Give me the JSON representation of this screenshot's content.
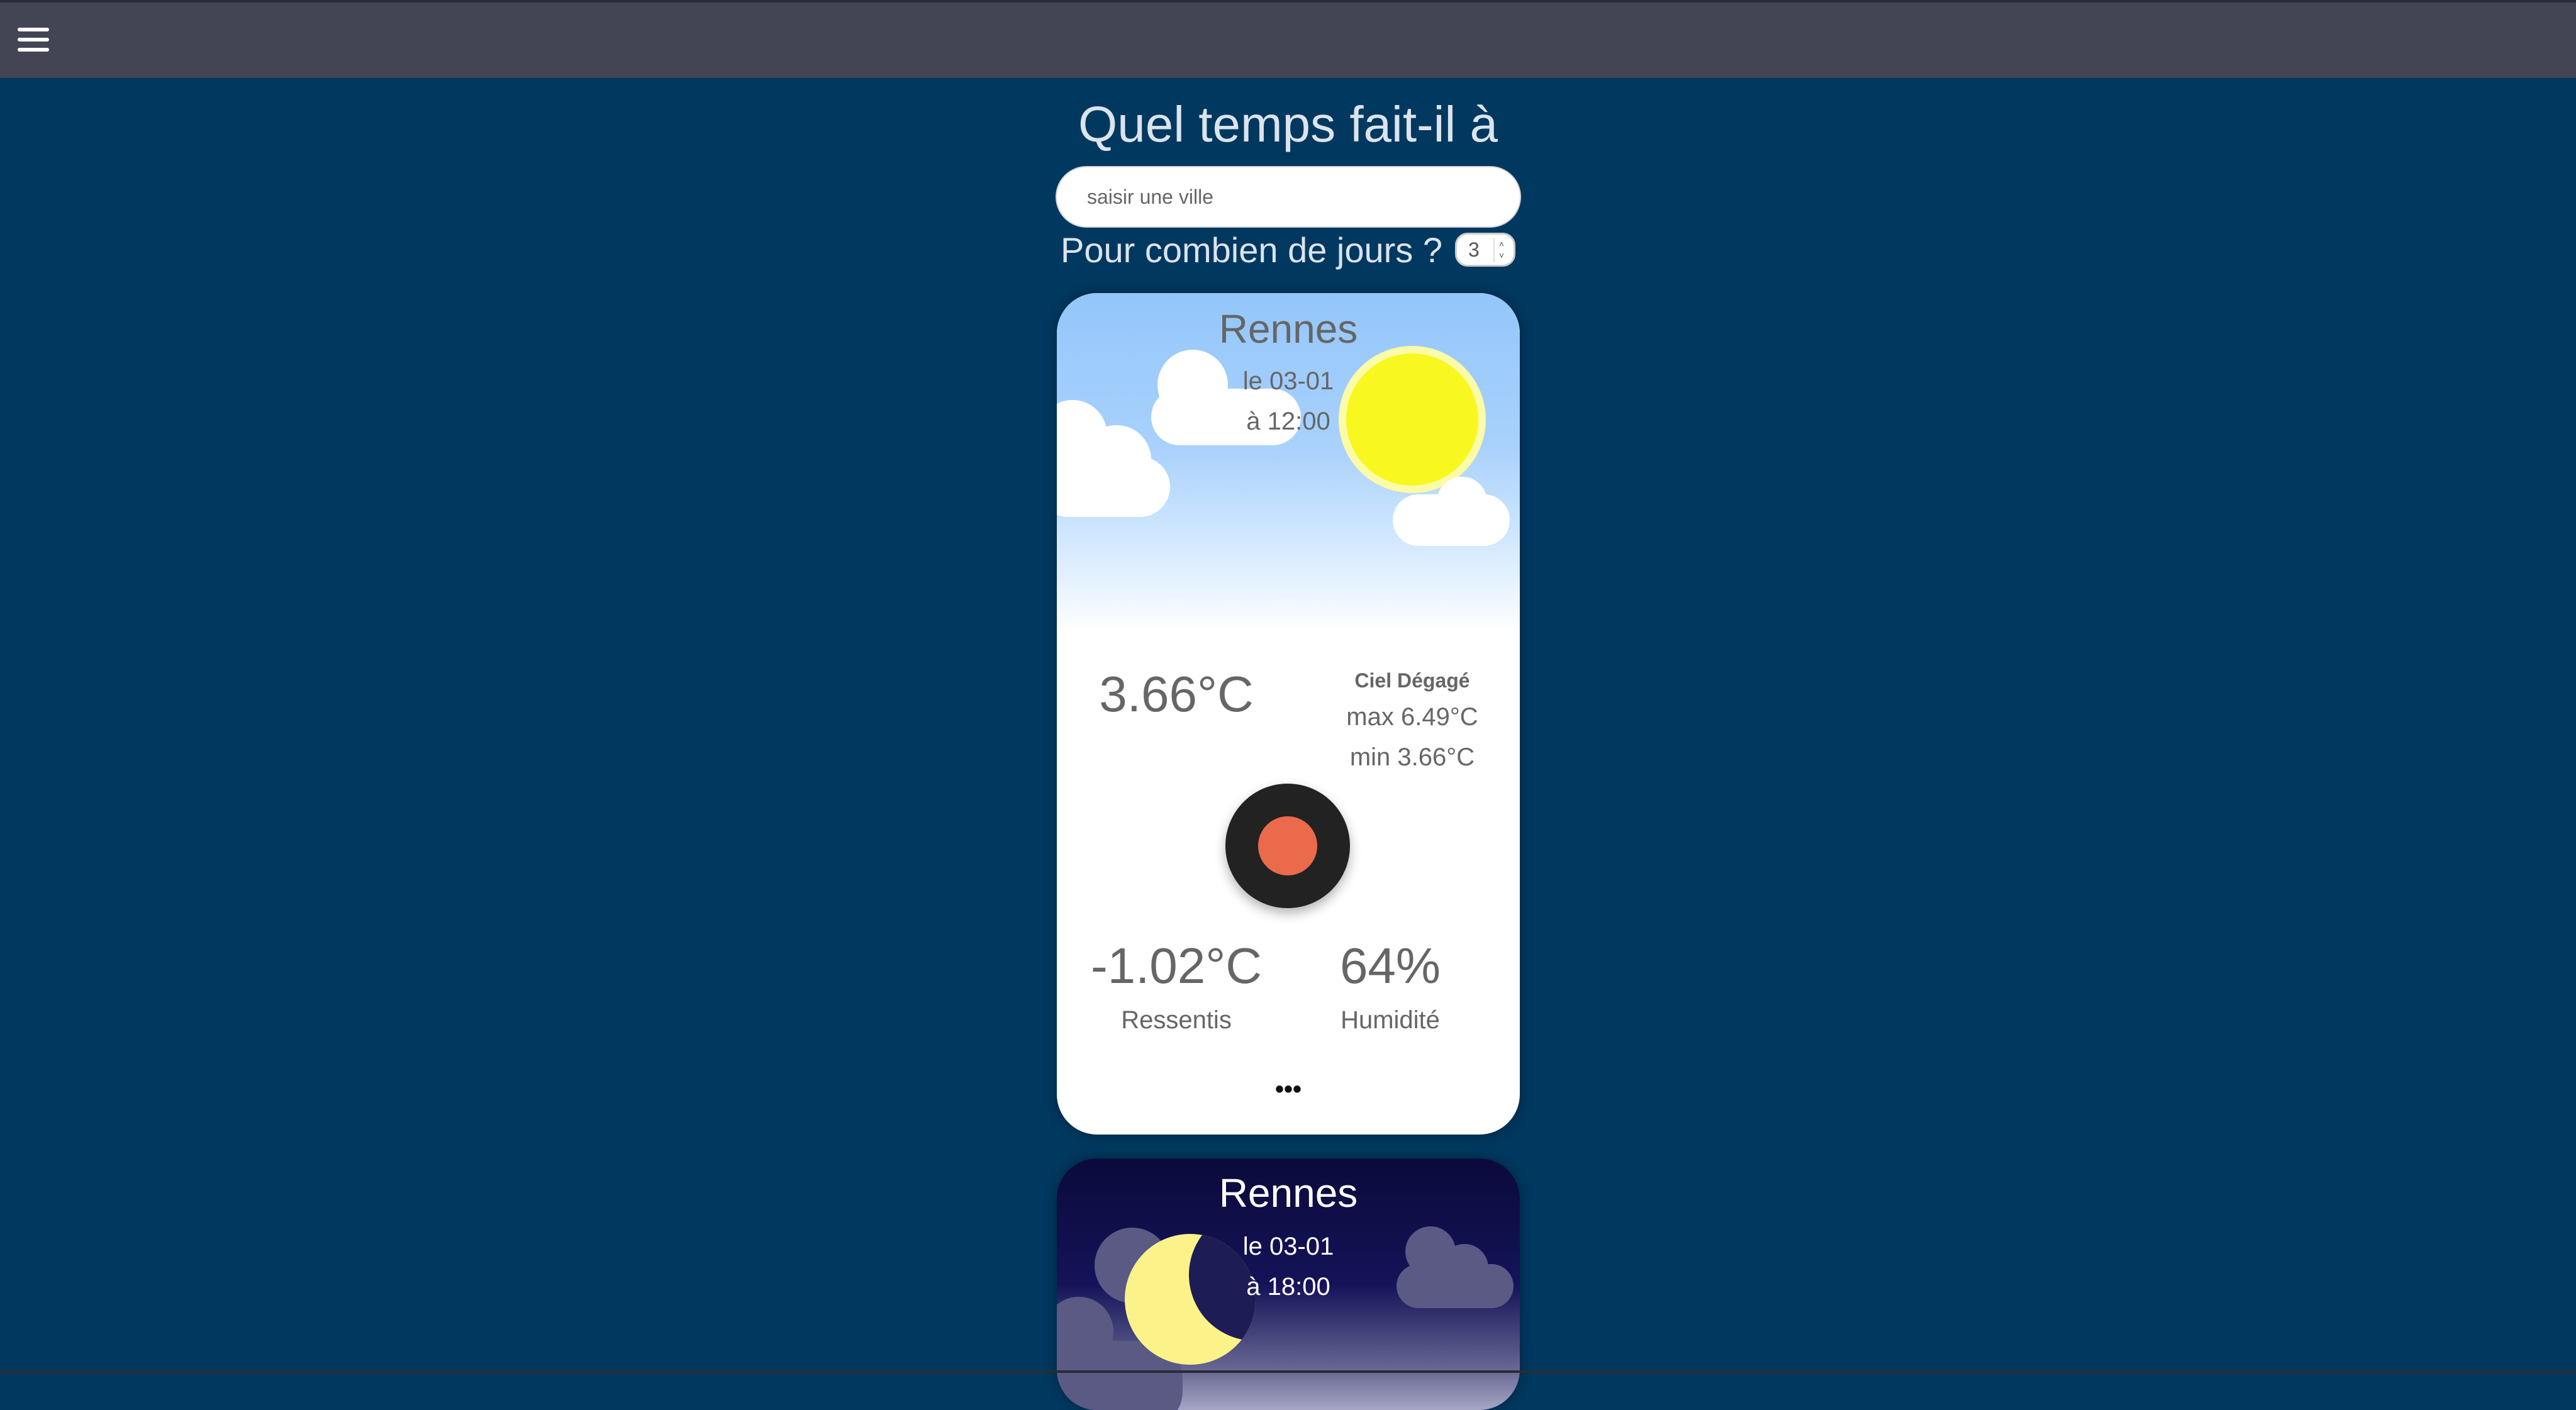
{
  "search": {
    "title": "Quel temps fait-il à",
    "placeholder": "saisir une ville",
    "days_label": "Pour combien de jours ?",
    "days_value": "3"
  },
  "forecasts": [
    {
      "city": "Rennes",
      "date": "le 03-01",
      "time": "à 12:00",
      "temperature": "3.66°C",
      "description": "Ciel Dégagé",
      "max": "max 6.49°C",
      "min": "min 3.66°C",
      "feels_like": "-1.02°C",
      "feels_like_label": "Ressentis",
      "humidity": "64%",
      "humidity_label": "Humidité",
      "more": "•••",
      "sky": "day",
      "icon": "sun-icon"
    },
    {
      "city": "Rennes",
      "date": "le 03-01",
      "time": "à 18:00",
      "sky": "night",
      "icon": "moon-icon"
    }
  ],
  "icons": {
    "menu": "hamburger-menu-icon",
    "record": "record-button"
  },
  "colors": {
    "background": "#00385f",
    "topbar": "#434554",
    "sun": "#f8f820",
    "moon": "#fbf289",
    "record_dot": "#ec6a4c"
  }
}
